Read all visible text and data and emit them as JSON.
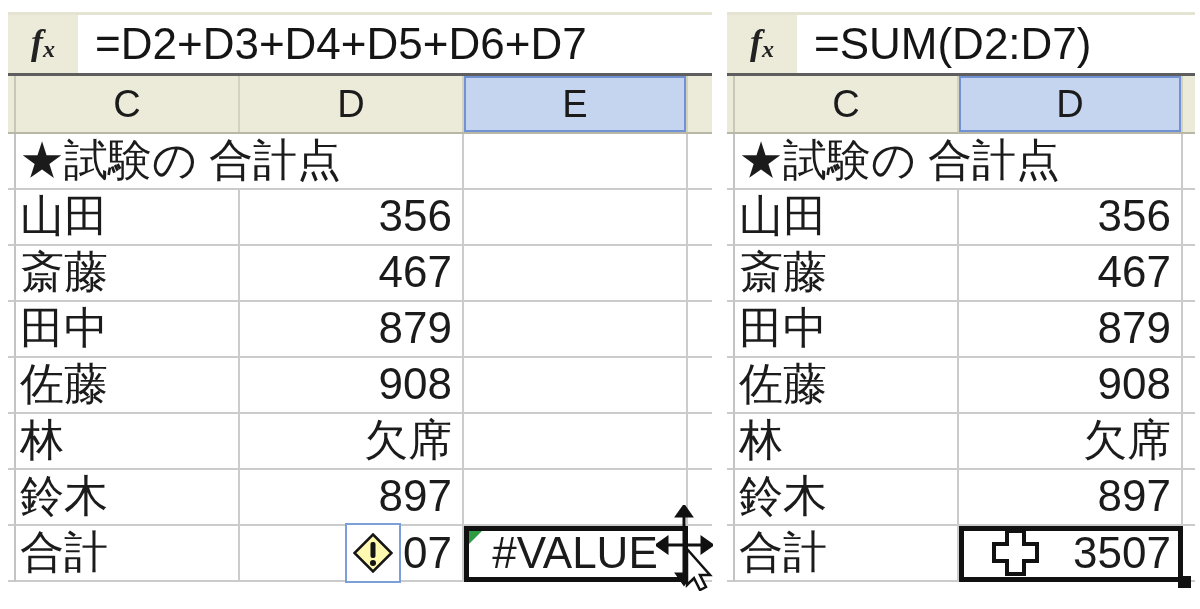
{
  "panels": [
    {
      "formula_bar": {
        "function_button": "f$_{x}$",
        "formula": "=D2+D3+D4+D5+D6+D7"
      },
      "columns": [
        {
          "label": "C",
          "selected": false
        },
        {
          "label": "D",
          "selected": false
        },
        {
          "label": "E",
          "selected": true
        }
      ],
      "rows": [
        {
          "cells": [
            {
              "kind": "heading",
              "text": "★試験の 合計点",
              "selected": false
            }
          ]
        },
        {
          "cells": [
            {
              "kind": "label",
              "text": "山田",
              "selected": false
            },
            {
              "kind": "value",
              "text": "356",
              "selected": false
            }
          ]
        },
        {
          "cells": [
            {
              "kind": "label",
              "text": "斎藤",
              "selected": false
            },
            {
              "kind": "value",
              "text": "467",
              "selected": false
            }
          ]
        },
        {
          "cells": [
            {
              "kind": "label",
              "text": "田中",
              "selected": false
            },
            {
              "kind": "value",
              "text": "879",
              "selected": false
            }
          ]
        },
        {
          "cells": [
            {
              "kind": "label",
              "text": "佐藤",
              "selected": false
            },
            {
              "kind": "value",
              "text": "908",
              "selected": false
            }
          ]
        },
        {
          "cells": [
            {
              "kind": "label",
              "text": "林",
              "selected": false
            },
            {
              "kind": "value",
              "text": "欠席",
              "selected": false
            }
          ]
        },
        {
          "cells": [
            {
              "kind": "label",
              "text": "鈴木",
              "selected": false
            },
            {
              "kind": "value",
              "text": "897",
              "selected": false
            }
          ]
        },
        {
          "cells": [
            {
              "kind": "label",
              "text": "合計",
              "selected": false
            },
            {
              "kind": "value",
              "text": "07",
              "selected": false,
              "error_options": true
            },
            {
              "kind": "error",
              "text": "#VALUE",
              "selected": true,
              "error_indicator": true
            }
          ]
        }
      ],
      "pointer": {
        "kind": "move"
      }
    },
    {
      "formula_bar": {
        "function_button": "f$_{x}$",
        "formula": "=SUM(D2:D7)"
      },
      "columns": [
        {
          "label": "C",
          "selected": false
        },
        {
          "label": "D",
          "selected": true
        }
      ],
      "rows": [
        {
          "cells": [
            {
              "kind": "heading",
              "text": "★試験の 合計点",
              "selected": false
            }
          ]
        },
        {
          "cells": [
            {
              "kind": "label",
              "text": "山田",
              "selected": false
            },
            {
              "kind": "value",
              "text": "356",
              "selected": false
            }
          ]
        },
        {
          "cells": [
            {
              "kind": "label",
              "text": "斎藤",
              "selected": false
            },
            {
              "kind": "value",
              "text": "467",
              "selected": false
            }
          ]
        },
        {
          "cells": [
            {
              "kind": "label",
              "text": "田中",
              "selected": false
            },
            {
              "kind": "value",
              "text": "879",
              "selected": false
            }
          ]
        },
        {
          "cells": [
            {
              "kind": "label",
              "text": "佐藤",
              "selected": false
            },
            {
              "kind": "value",
              "text": "908",
              "selected": false
            }
          ]
        },
        {
          "cells": [
            {
              "kind": "label",
              "text": "林",
              "selected": false
            },
            {
              "kind": "value",
              "text": "欠席",
              "selected": false
            }
          ]
        },
        {
          "cells": [
            {
              "kind": "label",
              "text": "鈴木",
              "selected": false
            },
            {
              "kind": "value",
              "text": "897",
              "selected": false
            }
          ]
        },
        {
          "cells": [
            {
              "kind": "label",
              "text": "合計",
              "selected": false
            },
            {
              "kind": "value",
              "text": "3507",
              "selected": true,
              "fill_handle": true
            }
          ]
        }
      ],
      "pointer": {
        "kind": "cross"
      }
    }
  ]
}
